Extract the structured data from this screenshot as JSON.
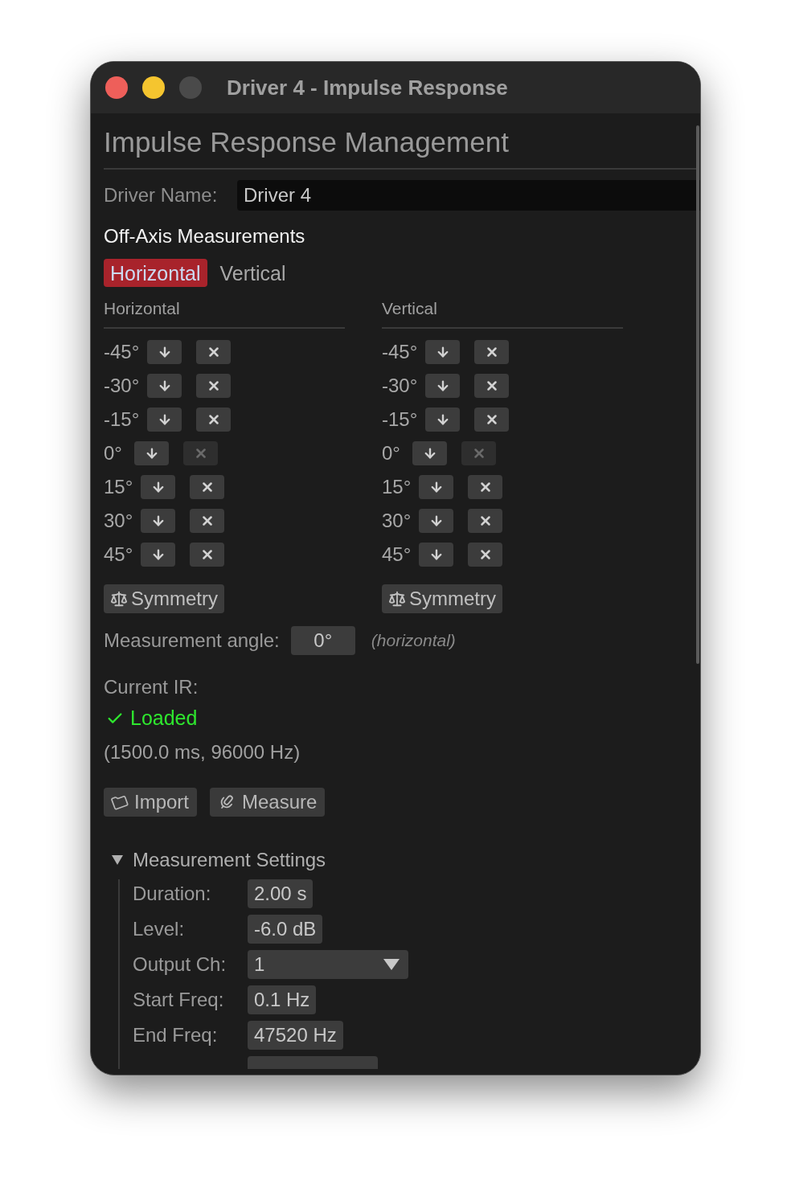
{
  "window": {
    "title": "Driver 4 - Impulse Response"
  },
  "heading": "Impulse Response Management",
  "driver_name": {
    "label": "Driver Name:",
    "value": "Driver 4"
  },
  "off_axis": {
    "title": "Off-Axis Measurements",
    "tabs": [
      {
        "label": "Horizontal",
        "selected": true
      },
      {
        "label": "Vertical",
        "selected": false
      }
    ],
    "columns": [
      {
        "title": "Horizontal",
        "symmetry": "Symmetry",
        "angles": [
          {
            "label": "-45°",
            "delete_disabled": false
          },
          {
            "label": "-30°",
            "delete_disabled": false
          },
          {
            "label": "-15°",
            "delete_disabled": false
          },
          {
            "label": "0°",
            "delete_disabled": true
          },
          {
            "label": "15°",
            "delete_disabled": false
          },
          {
            "label": "30°",
            "delete_disabled": false
          },
          {
            "label": "45°",
            "delete_disabled": false
          }
        ]
      },
      {
        "title": "Vertical",
        "symmetry": "Symmetry",
        "angles": [
          {
            "label": "-45°",
            "delete_disabled": false
          },
          {
            "label": "-30°",
            "delete_disabled": false
          },
          {
            "label": "-15°",
            "delete_disabled": false
          },
          {
            "label": "0°",
            "delete_disabled": true
          },
          {
            "label": "15°",
            "delete_disabled": false
          },
          {
            "label": "30°",
            "delete_disabled": false
          },
          {
            "label": "45°",
            "delete_disabled": false
          }
        ]
      }
    ]
  },
  "measurement_angle": {
    "label": "Measurement angle:",
    "value": "0°",
    "note": "(horizontal)"
  },
  "current_ir": {
    "label": "Current IR:",
    "status": "Loaded",
    "loaded": true,
    "details": "(1500.0 ms, 96000 Hz)"
  },
  "actions": [
    {
      "kind": "import",
      "label": "Import"
    },
    {
      "kind": "measure",
      "label": "Measure"
    }
  ],
  "settings": {
    "title": "Measurement Settings",
    "expanded": true,
    "fields": [
      {
        "kind": "value",
        "label": "Duration:",
        "value": "2.00 s"
      },
      {
        "kind": "value",
        "label": "Level:",
        "value": "-6.0 dB"
      },
      {
        "kind": "dropdown",
        "label": "Output Ch:",
        "value": "1"
      },
      {
        "kind": "value",
        "label": "Start Freq:",
        "value": "0.1 Hz"
      },
      {
        "kind": "value",
        "label": "End Freq:",
        "value": "47520 Hz"
      }
    ]
  }
}
